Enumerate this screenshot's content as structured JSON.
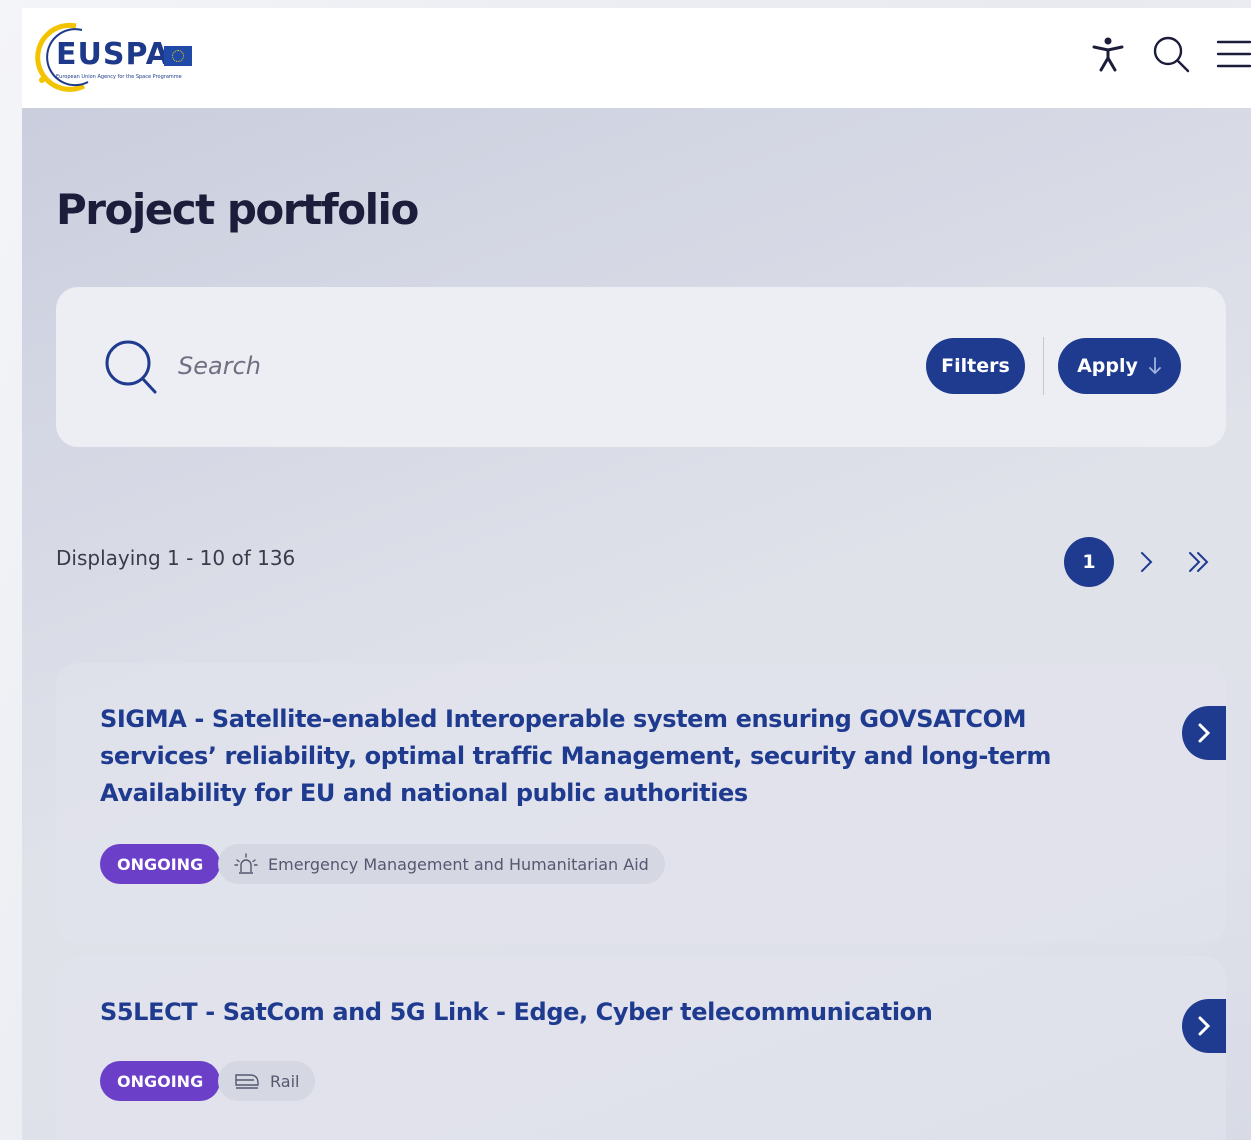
{
  "header": {
    "logo_text": "EUSPA",
    "logo_subtext": "European Union Agency for the Space Programme",
    "accessibility_label": "accessibility",
    "icons": [
      "accessibility-icon",
      "search-icon",
      "menu-icon"
    ]
  },
  "page": {
    "title": "Project portfolio"
  },
  "search": {
    "placeholder": "Search",
    "filters_label": "Filters",
    "apply_label": "Apply"
  },
  "results": {
    "count_text": "Displaying 1 - 10 of 136",
    "current_page": "1"
  },
  "projects": [
    {
      "title": "SIGMA - Satellite-enabled Interoperable system ensuring GOVSATCOM services’ reliability, optimal traffic Management, security and long-term Availability for EU and national public authorities",
      "status": "ONGOING",
      "category": "Emergency Management and Humanitarian Aid",
      "category_icon": "siren-icon"
    },
    {
      "title": "S5LECT - SatCom and 5G Link - Edge, Cyber telecommunication",
      "status": "ONGOING",
      "category": "Rail",
      "category_icon": "train-icon"
    }
  ],
  "colors": {
    "primary": "#1f3b8f",
    "status_ongoing": "#6b3fc8",
    "title_dark": "#1b1d3a"
  }
}
